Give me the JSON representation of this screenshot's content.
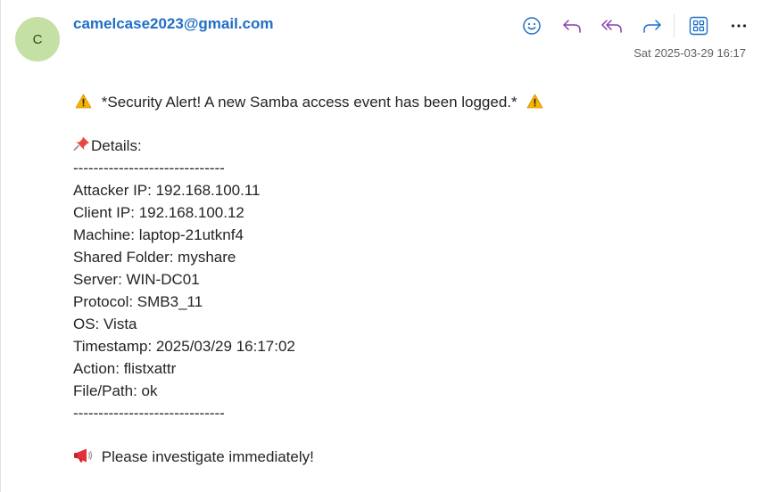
{
  "header": {
    "avatar_initial": "C",
    "sender": "camelcase2023@gmail.com",
    "date": "Sat 2025-03-29 16:17"
  },
  "toolbar": {
    "icons": [
      "smiley-icon",
      "reply-icon",
      "reply-all-icon",
      "forward-icon",
      "apps-icon",
      "more-icon"
    ],
    "accent_color": "#1f6fc5",
    "reply_color": "#8a3fa8"
  },
  "message": {
    "alert": "*Security Alert! A new Samba access event has been logged.*",
    "details_heading": "Details:",
    "separator": "------------------------------",
    "details": [
      "Attacker IP: 192.168.100.11",
      "Client IP: 192.168.100.12",
      "Machine: laptop-21utknf4",
      "Shared Folder: myshare",
      "Server: WIN-DC01",
      "Protocol: SMB3_11",
      "OS: Vista",
      "Timestamp: 2025/03/29 16:17:02",
      "Action: flistxattr",
      "File/Path: ok"
    ],
    "closing": "Please investigate immediately!"
  }
}
